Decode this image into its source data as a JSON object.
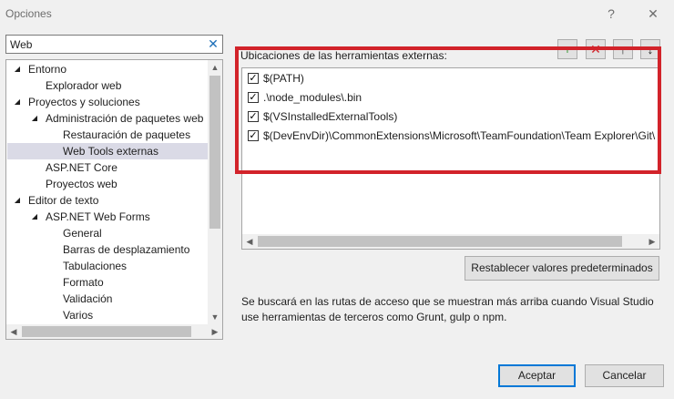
{
  "window": {
    "title": "Opciones",
    "help_icon": "?",
    "close_icon": "✕"
  },
  "search": {
    "value": "Web",
    "clear_icon": "✕"
  },
  "tree": {
    "rows": [
      {
        "label": "Entorno",
        "arrow": "◢"
      },
      {
        "label": "Explorador web",
        "arrow": ""
      },
      {
        "label": "Proyectos y soluciones",
        "arrow": "◢"
      },
      {
        "label": "Administración de paquetes web",
        "arrow": "◢"
      },
      {
        "label": "Restauración de paquetes",
        "arrow": ""
      },
      {
        "label": "Web Tools externas",
        "arrow": "",
        "selected": true
      },
      {
        "label": "ASP.NET Core",
        "arrow": ""
      },
      {
        "label": "Proyectos web",
        "arrow": ""
      },
      {
        "label": "Editor de texto",
        "arrow": "◢"
      },
      {
        "label": "ASP.NET Web Forms",
        "arrow": "◢"
      },
      {
        "label": "General",
        "arrow": ""
      },
      {
        "label": "Barras de desplazamiento",
        "arrow": ""
      },
      {
        "label": "Tabulaciones",
        "arrow": ""
      },
      {
        "label": "Formato",
        "arrow": ""
      },
      {
        "label": "Validación",
        "arrow": ""
      },
      {
        "label": "Varios",
        "arrow": ""
      }
    ]
  },
  "tools": {
    "label": "Ubicaciones de las herramientas externas:",
    "toolbar_icons": {
      "add": "+",
      "remove": "✕",
      "up": "↑",
      "down": "↓"
    },
    "items": [
      {
        "path": "$(PATH)",
        "checked": true
      },
      {
        "path": ".\\node_modules\\.bin",
        "checked": true
      },
      {
        "path": "$(VSInstalledExternalTools)",
        "checked": true
      },
      {
        "path": "$(DevEnvDir)\\CommonExtensions\\Microsoft\\TeamFoundation\\Team Explorer\\Git\\",
        "checked": true
      }
    ],
    "check_mark": "✓",
    "reset_button": "Restablecer valores predeterminados",
    "description": "Se buscará en las rutas de acceso que se muestran más arriba cuando Visual Studio use herramientas de terceros como Grunt, gulp o npm."
  },
  "footer": {
    "ok": "Aceptar",
    "cancel": "Cancelar"
  },
  "colors": {
    "highlight": "#d2232a",
    "selection": "#dadae6",
    "accent": "#0078d7",
    "add_green": "#3a9a3a",
    "remove_red": "#d2232a"
  }
}
